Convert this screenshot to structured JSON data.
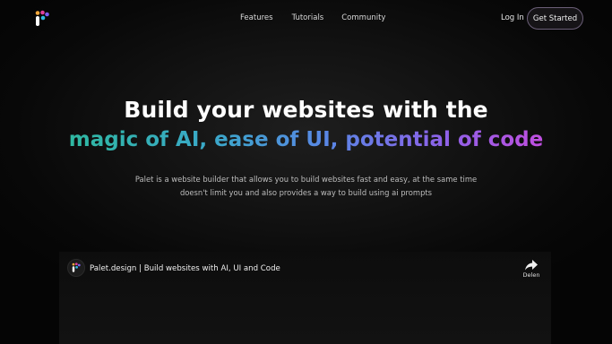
{
  "nav": {
    "links": [
      "Features",
      "Tutorials",
      "Community"
    ],
    "login_label": "Log In",
    "cta_label": "Get Started"
  },
  "hero": {
    "title": "Build your websites with the",
    "subtitle": "magic of AI, ease of UI, potential of code",
    "description": "Palet is a website builder that allows you to build websites fast and easy, at the same time doesn't limit you and also provides a way to build using ai prompts"
  },
  "video": {
    "title": "Palet.design | Build websites with AI, UI and Code",
    "share_label": "Delen"
  },
  "colors": {
    "gradient_start": "#2fb8a2",
    "gradient_mid": "#5a86e6",
    "gradient_end": "#c04fe0",
    "button_border": "#6b5f78"
  }
}
